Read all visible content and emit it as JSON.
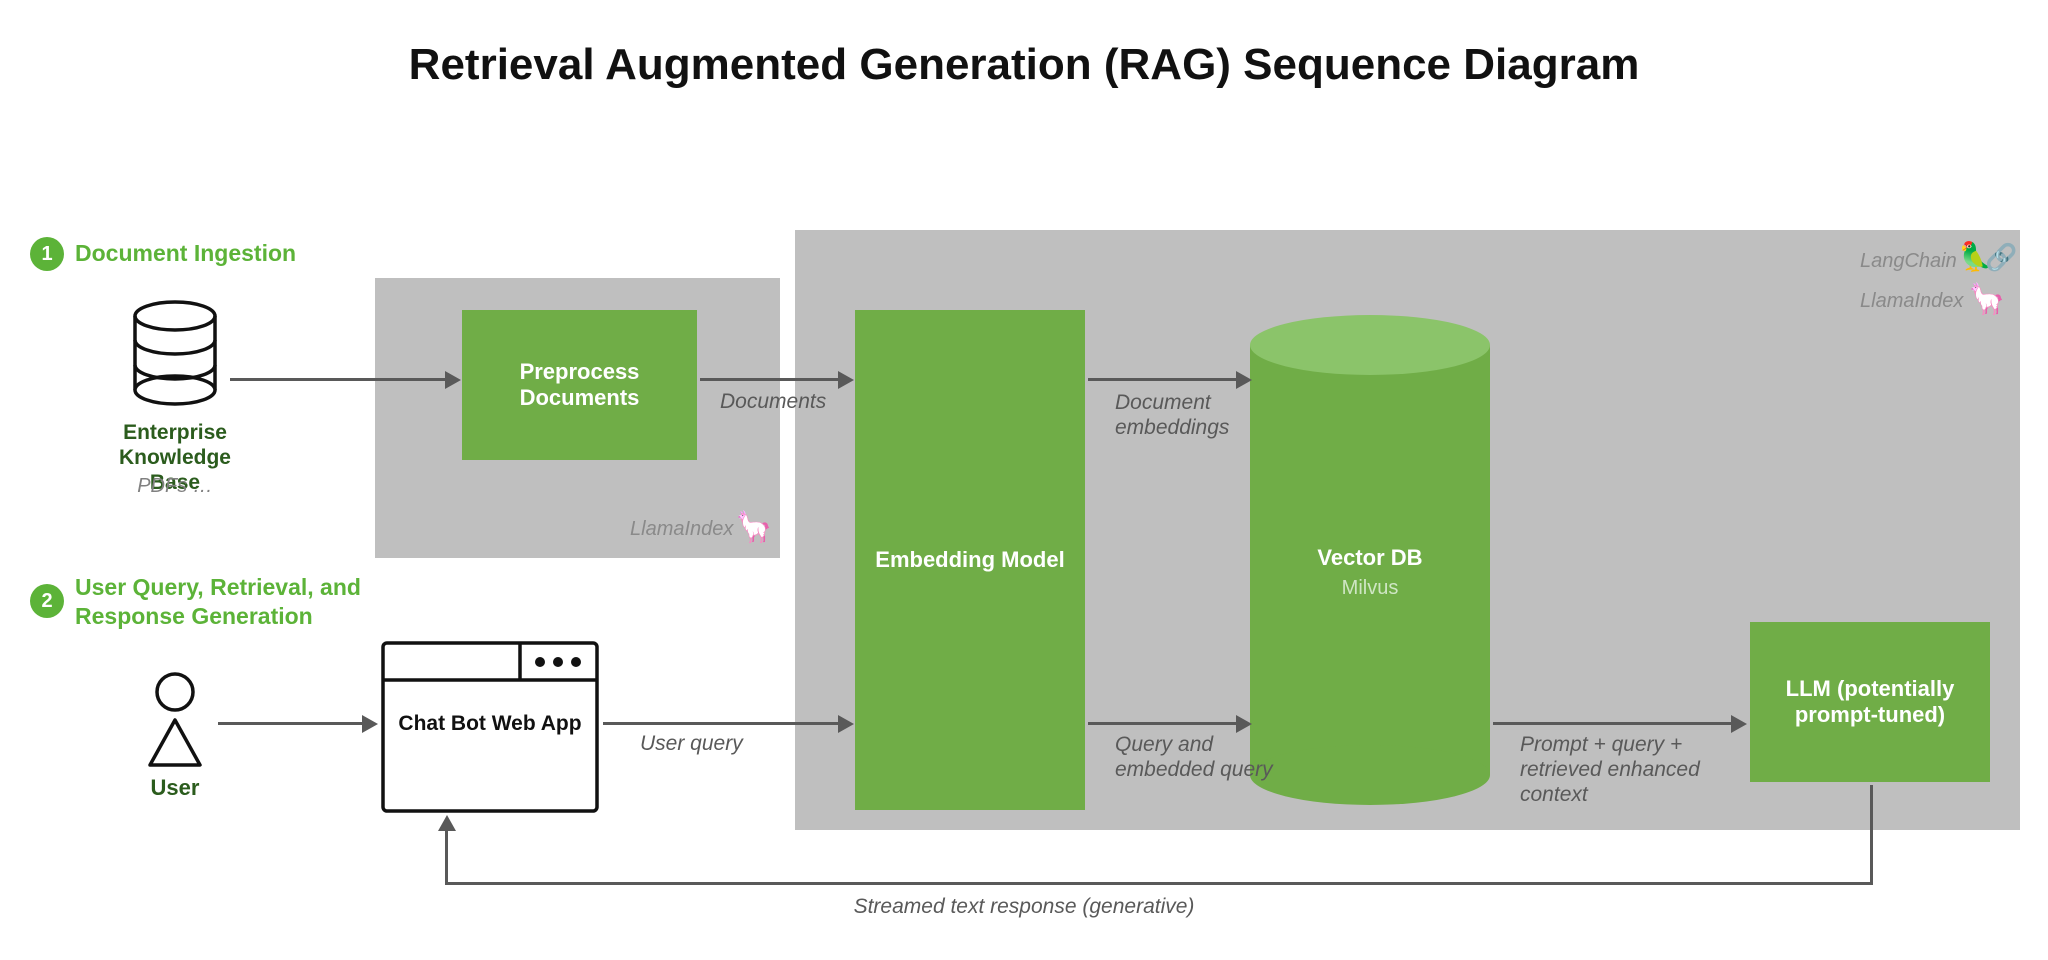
{
  "title": "Retrieval Augmented Generation (RAG) Sequence Diagram",
  "sections": {
    "s1": {
      "num": "1",
      "label": "Document Ingestion"
    },
    "s2": {
      "num": "2",
      "label": "User Query, Retrieval, and Response Generation"
    }
  },
  "actors": {
    "kb": {
      "title": "Enterprise Knowledge Base",
      "sub": "PDFs …"
    },
    "user": {
      "title": "User"
    },
    "webapp": {
      "title": "Chat Bot Web App"
    }
  },
  "boxes": {
    "preprocess": "Preprocess Documents",
    "embedding": "Embedding Model",
    "vectordb": {
      "title": "Vector DB",
      "sub": "Milvus"
    },
    "llm": "LLM (potentially prompt-tuned)"
  },
  "edges": {
    "documents": "Documents",
    "doc_embeddings": "Document embeddings",
    "user_query": "User query",
    "query_emb": "Query and embedded query",
    "prompt_ctx": "Prompt + query + retrieved enhanced context",
    "streamed": "Streamed text response (generative)"
  },
  "libs": {
    "llamaindex_small": "LlamaIndex",
    "langchain": "LangChain",
    "llamaindex_big": "LlamaIndex"
  },
  "icons": {
    "llama": "🦙",
    "parrot": "🦜",
    "chain": "🔗"
  },
  "colors": {
    "green": "#70ad47",
    "accent_green": "#5cb338",
    "gray_panel": "#bfbfbf"
  }
}
